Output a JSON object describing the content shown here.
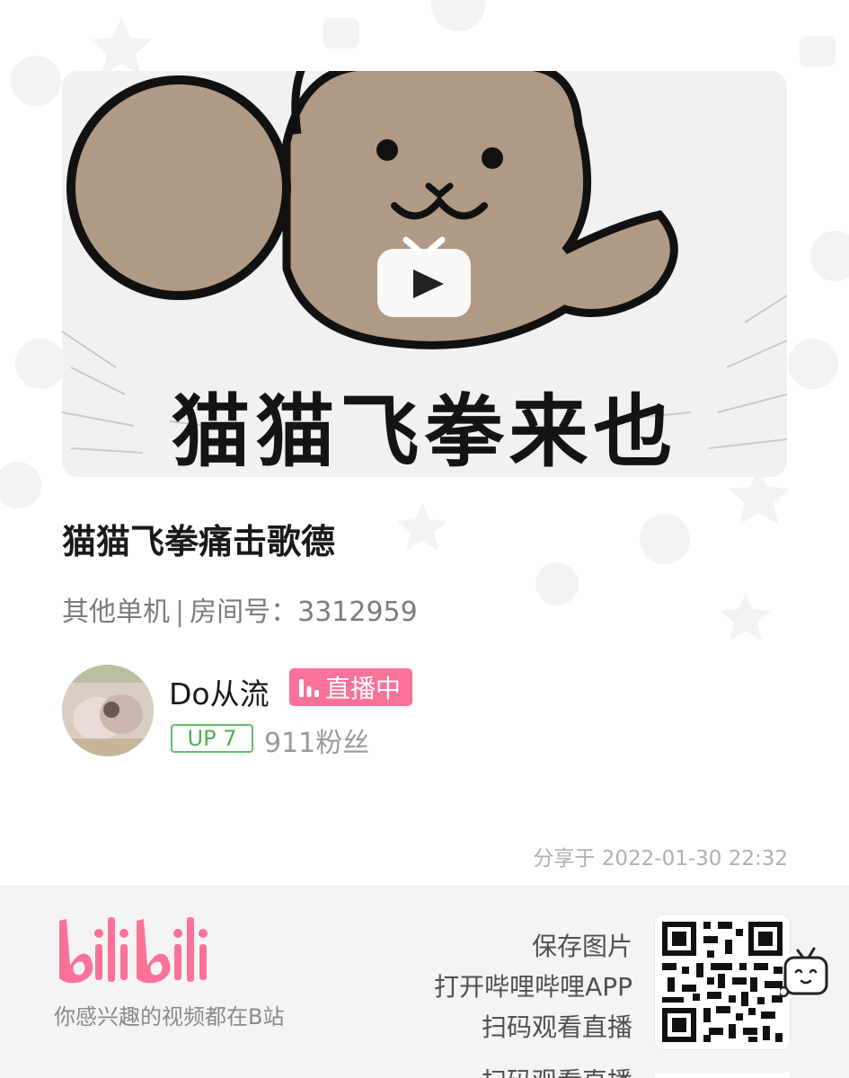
{
  "room": {
    "cover_caption": "猫猫飞拳来也",
    "title": "猫猫飞拳痛击歌德",
    "category": "其他单机",
    "room_label": "房间号：",
    "room_id": "3312959"
  },
  "streamer": {
    "name": "Do从流",
    "live_badge": "直播中",
    "level": "UP 7",
    "fans": "911粉丝"
  },
  "share": {
    "time": "分享于 2022-01-30 22:32"
  },
  "footer": {
    "tagline": "你感兴趣的视频都在B站",
    "lines": [
      "保存图片",
      "打开哔哩哔哩APP",
      "扫码观看直播"
    ],
    "next_line_partial": "扫码观看直播"
  },
  "colors": {
    "brand_pink": "#fb7299",
    "level_green": "#63bd6b",
    "footer_bg": "#f4f4f4"
  },
  "icons": [
    "play-icon",
    "live-bars-icon",
    "bilibili-logo",
    "qr-code",
    "tv-mascot-icon"
  ]
}
